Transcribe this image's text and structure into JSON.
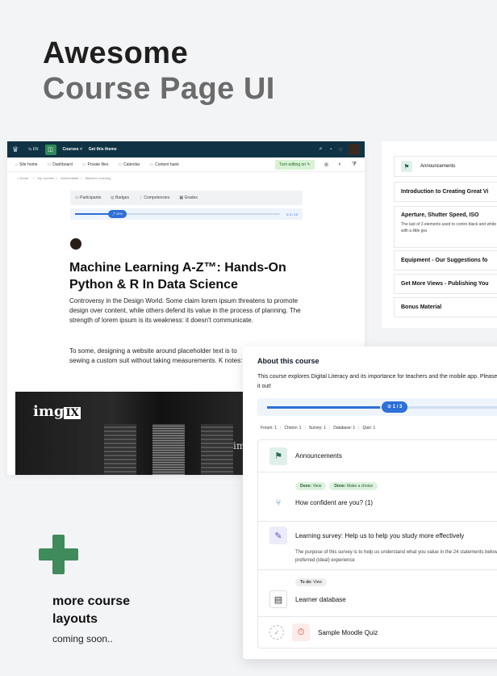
{
  "hero": {
    "line1": "Awesome",
    "line2": "Course Page UI"
  },
  "main_card": {
    "topbar": {
      "lang": "EN",
      "nav1": "Courses",
      "nav2": "Get this theme"
    },
    "subnav": {
      "items": [
        "Site home",
        "Dashboard",
        "Private files",
        "Calendar",
        "Content bank"
      ],
      "edit": "Turn editing on"
    },
    "breadcrumb": [
      "Home",
      "My courses",
      "Intermediate",
      "Machine Learning"
    ],
    "tabs": [
      "Participants",
      "Badges",
      "Competencies",
      "Grades"
    ],
    "progress": {
      "label": "20%",
      "count": "3 / 15",
      "fraction": 0.2
    },
    "title": "Machine Learning A-Z™: Hands-On Python & R In Data Science",
    "desc1": "Controversy in the Design World. Some claim lorem ipsum threatens to promote design over content, while others defend its value in the process of planning. The strength of lorem ipsum is its weakness: it doesn't communicate.",
    "desc2": "To some, designing a website around placeholder text is to sewing a custom suit without taking measurements. K notes:",
    "banner": {
      "logo": "img",
      "logo_box": "IX",
      "logo2": "img"
    }
  },
  "list_card": {
    "items": [
      {
        "label": "Announcements"
      },
      {
        "label": "Introduction to Creating Great Vi"
      },
      {
        "label": "Aperture, Shutter Speed, ISO",
        "desc": "The last of 3 elements used to contro black and white photo with a little gra"
      },
      {
        "label": "Equipment - Our Suggestions fo"
      },
      {
        "label": "Get More Views - Publishing You"
      },
      {
        "label": "Bonus Material"
      }
    ]
  },
  "about": {
    "title": "About this course",
    "desc": "This course explores Digital Literacy and its importance for teachers and the mobile app. Please try it out!",
    "progress": {
      "label": "1 / 3",
      "fraction": 0.333
    },
    "stats": [
      "Forum: 1",
      "Choice: 1",
      "Survey: 1",
      "Database: 1",
      "Quiz: 1"
    ],
    "rows": [
      {
        "name": "Announcements"
      },
      {
        "badges": [
          {
            "k": "Done:",
            "v": "View"
          },
          {
            "k": "Done:",
            "v": "Make a choice"
          }
        ],
        "name": "How confident are you? (1)"
      },
      {
        "name": "Learning survey: Help us to help you study more effectively",
        "sub": "The purpose of this survey is to help us understand what you value in the 24 statements below asks about your preferred (ideal) experience"
      },
      {
        "badges": [
          {
            "k": "To do:",
            "v": "View"
          }
        ],
        "name": "Learner database"
      },
      {
        "name": "Sample Moodle Quiz"
      }
    ]
  },
  "more": {
    "title": "more course layouts",
    "sub": "coming soon.."
  },
  "colors": {
    "brand_green": "#3f8b5b",
    "topbar": "#0f3344",
    "accent_blue": "#2e6fd8"
  }
}
